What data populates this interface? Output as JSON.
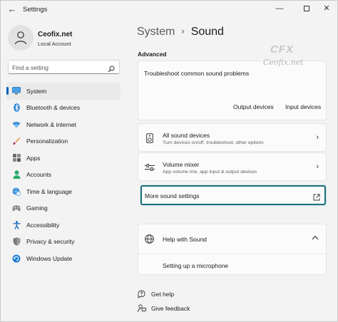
{
  "window": {
    "title": "Settings",
    "back_glyph": "←",
    "min_glyph": "—",
    "close_glyph": "✕"
  },
  "profile": {
    "name": "Ceofix.net",
    "account_type": "Local Account"
  },
  "search": {
    "placeholder": "Find a setting",
    "icon": "search-icon"
  },
  "nav": {
    "items": [
      {
        "label": "System",
        "icon": "monitor-icon",
        "active": true
      },
      {
        "label": "Bluetooth & devices",
        "icon": "bluetooth-icon"
      },
      {
        "label": "Network & internet",
        "icon": "wifi-icon"
      },
      {
        "label": "Personalization",
        "icon": "brush-icon"
      },
      {
        "label": "Apps",
        "icon": "apps-icon"
      },
      {
        "label": "Accounts",
        "icon": "person-icon"
      },
      {
        "label": "Time & language",
        "icon": "globe-clock-icon"
      },
      {
        "label": "Gaming",
        "icon": "gamepad-icon"
      },
      {
        "label": "Accessibility",
        "icon": "accessibility-icon"
      },
      {
        "label": "Privacy & security",
        "icon": "shield-icon"
      },
      {
        "label": "Windows Update",
        "icon": "update-icon"
      }
    ]
  },
  "breadcrumb": {
    "parent": "System",
    "separator": "›",
    "current": "Sound"
  },
  "advanced": {
    "heading": "Advanced",
    "troubleshoot": {
      "title": "Troubleshoot common sound problems",
      "output_link": "Output devices",
      "input_link": "Input devices"
    }
  },
  "watermark": {
    "logo": "CFX",
    "text": "Ceofix.net"
  },
  "rows": [
    {
      "title": "All sound devices",
      "subtitle": "Turn devices on/off, troubleshoot, other options",
      "icon": "speaker-device-icon",
      "chevron": "›"
    },
    {
      "title": "Volume mixer",
      "subtitle": "App volume mix, app input & output devices",
      "icon": "mixer-icon",
      "chevron": "›"
    }
  ],
  "more_sound": {
    "label": "More sound settings",
    "icon": "external-link-icon"
  },
  "help": {
    "title": "Help with Sound",
    "collapse_glyph": "^",
    "link": "Setting up a microphone"
  },
  "footer": {
    "get_help": "Get help",
    "give_feedback": "Give feedback"
  },
  "colors": {
    "accent": "#005fb8",
    "highlight_border": "#1c6e7b"
  }
}
